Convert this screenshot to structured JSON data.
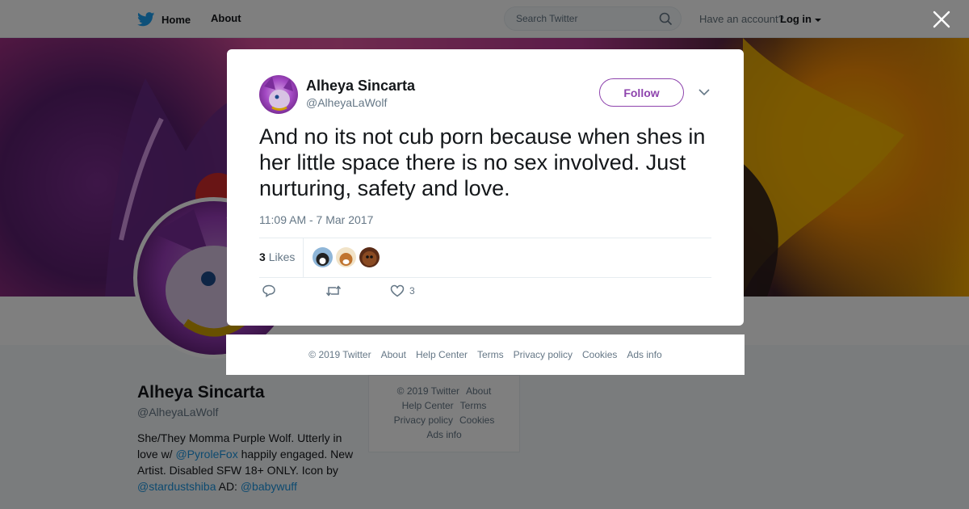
{
  "nav": {
    "home_label": "Home",
    "about_label": "About",
    "search_placeholder": "Search Twitter",
    "account_text": "Have an account?",
    "login_label": "Log in"
  },
  "profile": {
    "name": "Alheya Sincarta",
    "handle": "@AlheyaLaWolf",
    "bio_line1": "She/They Momma Purple Wolf. Utterly in love w/",
    "bio_mention1": "@PyroleFox",
    "bio_line2": "happily engaged. New Artist. Disabled SFW 18+ ONLY. Icon by",
    "bio_mention2": "@stardustshiba",
    "bio_ad": "AD:",
    "bio_mention3": "@babywuff"
  },
  "side_footer": {
    "copyright": "© 2019 Twitter",
    "about": "About",
    "help": "Help Center",
    "terms": "Terms",
    "privacy": "Privacy policy",
    "cookies": "Cookies",
    "ads": "Ads info"
  },
  "tweet": {
    "author_name": "Alheya Sincarta",
    "author_handle": "@AlheyaLaWolf",
    "follow_label": "Follow",
    "text": "And no its not cub porn because when shes in her little space there is no sex involved. Just nurturing, safety and love.",
    "timestamp": "11:09 AM - 7 Mar 2017",
    "likes_count": "3",
    "likes_label": "Likes",
    "like_action_count": "3"
  },
  "modal_footer": {
    "copyright": "© 2019 Twitter",
    "about": "About",
    "help": "Help Center",
    "terms": "Terms",
    "privacy": "Privacy policy",
    "cookies": "Cookies",
    "ads": "Ads info"
  },
  "colors": {
    "follow_accent": "#8e44ad",
    "link": "#1b95e0",
    "twitter_blue": "#1da1f2"
  }
}
